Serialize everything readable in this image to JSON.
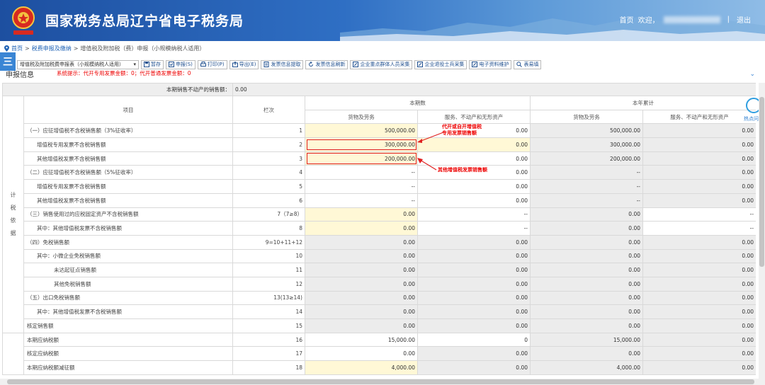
{
  "header": {
    "title": "国家税务总局辽宁省电子税务局",
    "nav_home": "首页",
    "nav_welcome": "欢迎，",
    "nav_sep": "|",
    "nav_logout": "退出"
  },
  "breadcrumb": {
    "home": "首页",
    "sep1": ">",
    "section": "税费申报及缴纳",
    "sep2": ">",
    "page": "增值税及附加税（费）申报（小规模纳税人适用）"
  },
  "toolbar": {
    "menu_icon_label": "三",
    "select_prefix": "表",
    "select_value": "增值税及附加税费申报表（小规模纳税人适用）",
    "buttons": [
      "暂存",
      "申报(S)",
      "打印(P)",
      "导出(E)",
      "发票信息提取",
      "发票信息刷新",
      "企业重点群体人员采集",
      "企业退役士兵采集",
      "电子资料维护",
      "表易填"
    ]
  },
  "report_title": "申报信息",
  "tip": "系统提示：代开专用发票金额：0；代开普通发票金额：0",
  "top_row": {
    "label": "本期销售不动产的销售额：",
    "value": "0.00"
  },
  "table": {
    "head": {
      "item": "项目",
      "col": "栏次",
      "current": "本期数",
      "ytd": "本年累计",
      "goods": "货物及劳务",
      "services": "服务、不动产和无形资产"
    },
    "side_1": [
      "计",
      "税",
      "依",
      "据"
    ],
    "side_2": [
      "税"
    ],
    "rows": [
      {
        "label": "（一）应征增值税不含税销售额（3%征收率）",
        "col": "1",
        "c1": "500,000.00",
        "c2": "0.00",
        "c3": "500,000.00",
        "c4": "0.00"
      },
      {
        "label": "增值税专用发票不含税销售额",
        "col": "2",
        "c1": "300,000.00",
        "c2": "0.00",
        "c3": "300,000.00",
        "c4": "0.00"
      },
      {
        "label": "其他增值税发票不含税销售额",
        "col": "3",
        "c1": "200,000.00",
        "c2": "0.00",
        "c3": "200,000.00",
        "c4": "0.00"
      },
      {
        "label": "（二）应征增值税不含税销售额（5%征收率）",
        "col": "4",
        "c1": "--",
        "c2": "0.00",
        "c3": "--",
        "c4": "0.00"
      },
      {
        "label": "增值税专用发票不含税销售额",
        "col": "5",
        "c1": "--",
        "c2": "0.00",
        "c3": "--",
        "c4": "0.00"
      },
      {
        "label": "其他增值税发票不含税销售额",
        "col": "6",
        "c1": "--",
        "c2": "0.00",
        "c3": "--",
        "c4": "0.00"
      },
      {
        "label": "（三）销售使用过的应税固定资产不含税销售额",
        "col": "7（7≥8）",
        "c1": "0.00",
        "c2": "--",
        "c3": "0.00",
        "c4": "--"
      },
      {
        "label": "其中：其他增值税发票不含税销售额",
        "col": "8",
        "c1": "0.00",
        "c2": "--",
        "c3": "0.00",
        "c4": "--"
      },
      {
        "label": "（四）免税销售额",
        "col": "9=10+11+12",
        "c1": "0.00",
        "c2": "0.00",
        "c3": "0.00",
        "c4": "0.00"
      },
      {
        "label": "其中：小微企业免税销售额",
        "col": "10",
        "c1": "0.00",
        "c2": "0.00",
        "c3": "0.00",
        "c4": "0.00"
      },
      {
        "label": "未达起征点销售额",
        "col": "11",
        "c1": "0.00",
        "c2": "0.00",
        "c3": "0.00",
        "c4": "0.00"
      },
      {
        "label": "其他免税销售额",
        "col": "12",
        "c1": "0.00",
        "c2": "0.00",
        "c3": "0.00",
        "c4": "0.00"
      },
      {
        "label": "（五）出口免税销售额",
        "col": "13(13≥14)",
        "c1": "0.00",
        "c2": "0.00",
        "c3": "0.00",
        "c4": "0.00"
      },
      {
        "label": "其中：其他增值税发票不含税销售额",
        "col": "14",
        "c1": "0.00",
        "c2": "0.00",
        "c3": "0.00",
        "c4": "0.00"
      },
      {
        "label": "核定销售额",
        "col": "15",
        "c1": "0.00",
        "c2": "0.00",
        "c3": "0.00",
        "c4": "0.00"
      },
      {
        "label": "本期应纳税额",
        "col": "16",
        "c1": "15,000.00",
        "c2": "0",
        "c3": "15,000.00",
        "c4": "0.00"
      },
      {
        "label": "核定应纳税额",
        "col": "17",
        "c1": "0.00",
        "c2": "0.00",
        "c3": "0.00",
        "c4": "0.00"
      },
      {
        "label": "本期应纳税额减征额",
        "col": "18",
        "c1": "4,000.00",
        "c2": "0.00",
        "c3": "4,000.00",
        "c4": "0.00"
      }
    ]
  },
  "annotations": {
    "a1_line1": "代开或自开增值税",
    "a1_line2": "专用发票销售额",
    "a2": "其他增值税发票销售额"
  },
  "float_help": "热点问题",
  "colors": {
    "header_blue": "#1d4fa0",
    "accent": "#3a85d4",
    "highlight_red": "#e02020",
    "input_yellow": "#fff8d6"
  }
}
